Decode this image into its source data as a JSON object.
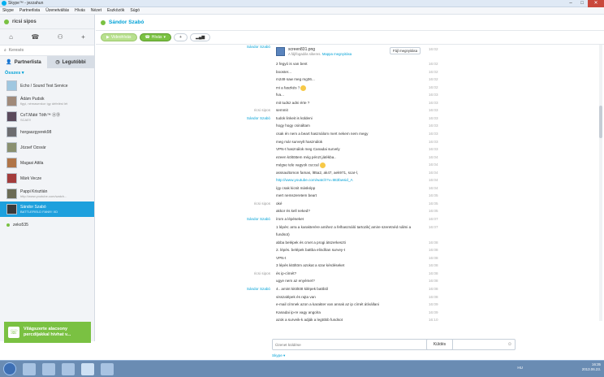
{
  "window": {
    "title": "Skype™ - jezzahun",
    "controls": [
      "–",
      "□",
      "✕"
    ]
  },
  "menu": [
    "Skype",
    "Partnerlista",
    "Üzenetváltás",
    "Hívás",
    "Nézet",
    "Eszközök",
    "Súgó"
  ],
  "profile": {
    "name": "ricsi sipos"
  },
  "search": {
    "placeholder": "Keresés"
  },
  "tabs": {
    "contacts": "Partnerlista",
    "recent": "Legutóbbi"
  },
  "filter": "Összes",
  "contacts": [
    {
      "name": "Echo / Sound Test Service",
      "mood": ""
    },
    {
      "name": "Ádám Pudsik",
      "mood": "figyi, némasenkor így défelést lét"
    },
    {
      "name": "CoT.Máté Tóth™ ⓍⒹ",
      "mood": "SCAE!!"
    },
    {
      "name": "horgaszgyerek98",
      "mood": ""
    },
    {
      "name": "József Ozsvár",
      "mood": ""
    },
    {
      "name": "Magasi Attila",
      "mood": ""
    },
    {
      "name": "Márk Vecze",
      "mood": ""
    },
    {
      "name": "Pappi Krisztián",
      "mood": "http://www.youtube.com/watch..."
    },
    {
      "name": "Sándor Szabó",
      "mood": "BATTLEFIELD FAN!!!! XD"
    },
    {
      "name": "zeko535",
      "mood": ""
    }
  ],
  "ad": {
    "line1": "Világszerte alacsony",
    "line2": "percdíjakkal hívhat v..."
  },
  "chat": {
    "contact_name": "Sándor Szabó",
    "video_btn": "Videohívás",
    "call_btn": "Hívás",
    "file": {
      "name": "screen831.png",
      "status": "A fájlfogadás sikeres.",
      "link": "Mappa megnyitása",
      "open": "Fájl megnyitása",
      "time": "16:02"
    },
    "messages": [
      {
        "sender": "Sándor Szabó",
        "me": false,
        "text": "",
        "time": ""
      },
      {
        "sender": "",
        "me": false,
        "text": "2 fegyó is van bent",
        "time": "16:02"
      },
      {
        "sender": "",
        "me": false,
        "text": "booster...",
        "time": "16:02"
      },
      {
        "sender": "",
        "me": false,
        "text": "m249 saw meg mg36...",
        "time": "16:02"
      },
      {
        "sender": "",
        "me": false,
        "text": "mi a faszkés ?",
        "time": "16:02",
        "emo": true
      },
      {
        "sender": "",
        "me": false,
        "text": "fva...",
        "time": "16:03"
      },
      {
        "sender": "",
        "me": false,
        "text": "mit tudsz adni érte ?",
        "time": "16:03"
      },
      {
        "sender": "ricsi sipos",
        "me": true,
        "text": "semmit",
        "time": "16:03"
      },
      {
        "sender": "Sándor Szabó",
        "me": false,
        "text": "tudok linkeit is küldeni",
        "time": "16:03"
      },
      {
        "sender": "",
        "me": false,
        "text": "hogy hogy csináltam",
        "time": "16:03"
      },
      {
        "sender": "",
        "me": false,
        "text": "csak én nem a beart használom mert nekem nem megy",
        "time": "16:03"
      },
      {
        "sender": "",
        "me": false,
        "text": "meg már surveylt használok",
        "time": "16:03"
      },
      {
        "sender": "",
        "me": false,
        "text": "VPN-t használok meg Canadai survely",
        "time": "16:03"
      },
      {
        "sender": "",
        "me": false,
        "text": "ezeen költöttem még pénzt játékba..",
        "time": "16:04"
      },
      {
        "sender": "",
        "me": false,
        "text": "mégse tele vagyok cuccal",
        "time": "16:04",
        "emo": true
      },
      {
        "sender": "",
        "me": false,
        "text": "asssaultomon famas, l85a2, ak47, aek971, scar-l,",
        "time": "16:04"
      },
      {
        "sender": "",
        "me": false,
        "text": "http://www.youtube.com/watch?v=t6t3bwsid_A",
        "time": "16:04",
        "link": true
      },
      {
        "sender": "",
        "me": false,
        "text": "így csak kicsit másképp",
        "time": "16:04"
      },
      {
        "sender": "",
        "me": false,
        "text": "mert nemszeretem beart",
        "time": "16:05"
      },
      {
        "sender": "ricsi sipos",
        "me": true,
        "text": "oké",
        "time": "16:05"
      },
      {
        "sender": "",
        "me": false,
        "text": "akkor és kell neked?",
        "time": "16:05"
      },
      {
        "sender": "Sándor Szabó",
        "me": false,
        "text": "írom a lépéseket",
        "time": "16:07"
      },
      {
        "sender": "",
        "me": false,
        "text": "1 lépés: arra a karakterére amihez a felhasználó tartozik( amire szeretnéd nálmi a",
        "time": "16:07"
      },
      {
        "sender": "",
        "me": false,
        "text": "fundsot)",
        "time": ""
      },
      {
        "sender": "",
        "me": false,
        "text": "abba belépek és cmet a progi átszerkeszti",
        "time": "16:08"
      },
      {
        "sender": "",
        "me": false,
        "text": "2. lépés. belépek battba elindítan survey-t",
        "time": "16:08"
      },
      {
        "sender": "",
        "me": false,
        "text": "VPN-t",
        "time": "16:08"
      },
      {
        "sender": "",
        "me": false,
        "text": "3 lépés kitöltöm azokat a szar kérdéseket",
        "time": "16:08"
      },
      {
        "sender": "ricsi sipos",
        "me": true,
        "text": "és ip-címét?",
        "time": "16:08"
      },
      {
        "sender": "",
        "me": false,
        "text": "ugye nem az enyémet?",
        "time": "16:08"
      },
      {
        "sender": "Sándor Szabó",
        "me": false,
        "text": "4.. amint kitöltött kilépek battból",
        "time": "16:08"
      },
      {
        "sender": "",
        "me": false,
        "text": "visszalépek és rajta van",
        "time": "16:08"
      },
      {
        "sender": "",
        "me": false,
        "text": "e-mail címnek azon a karakter van annak az ip címét átívállani",
        "time": "16:09"
      },
      {
        "sender": "",
        "me": false,
        "text": "Kanadai ip-re vagy angolra",
        "time": "16:09"
      },
      {
        "sender": "",
        "me": false,
        "text": "azok a surveik-k adják a legtöbb fundsot",
        "time": "16:10"
      }
    ],
    "composer_placeholder": "Üzenet küldése",
    "send_btn": "Küldés",
    "skype_label": "Skype ▾"
  },
  "taskbar": {
    "lang": "HU",
    "time": "16:35",
    "date": "2013.06.23."
  },
  "colors": {
    "accent": "#00a1d6",
    "green": "#7ac142",
    "selected": "#1ea0dd"
  }
}
